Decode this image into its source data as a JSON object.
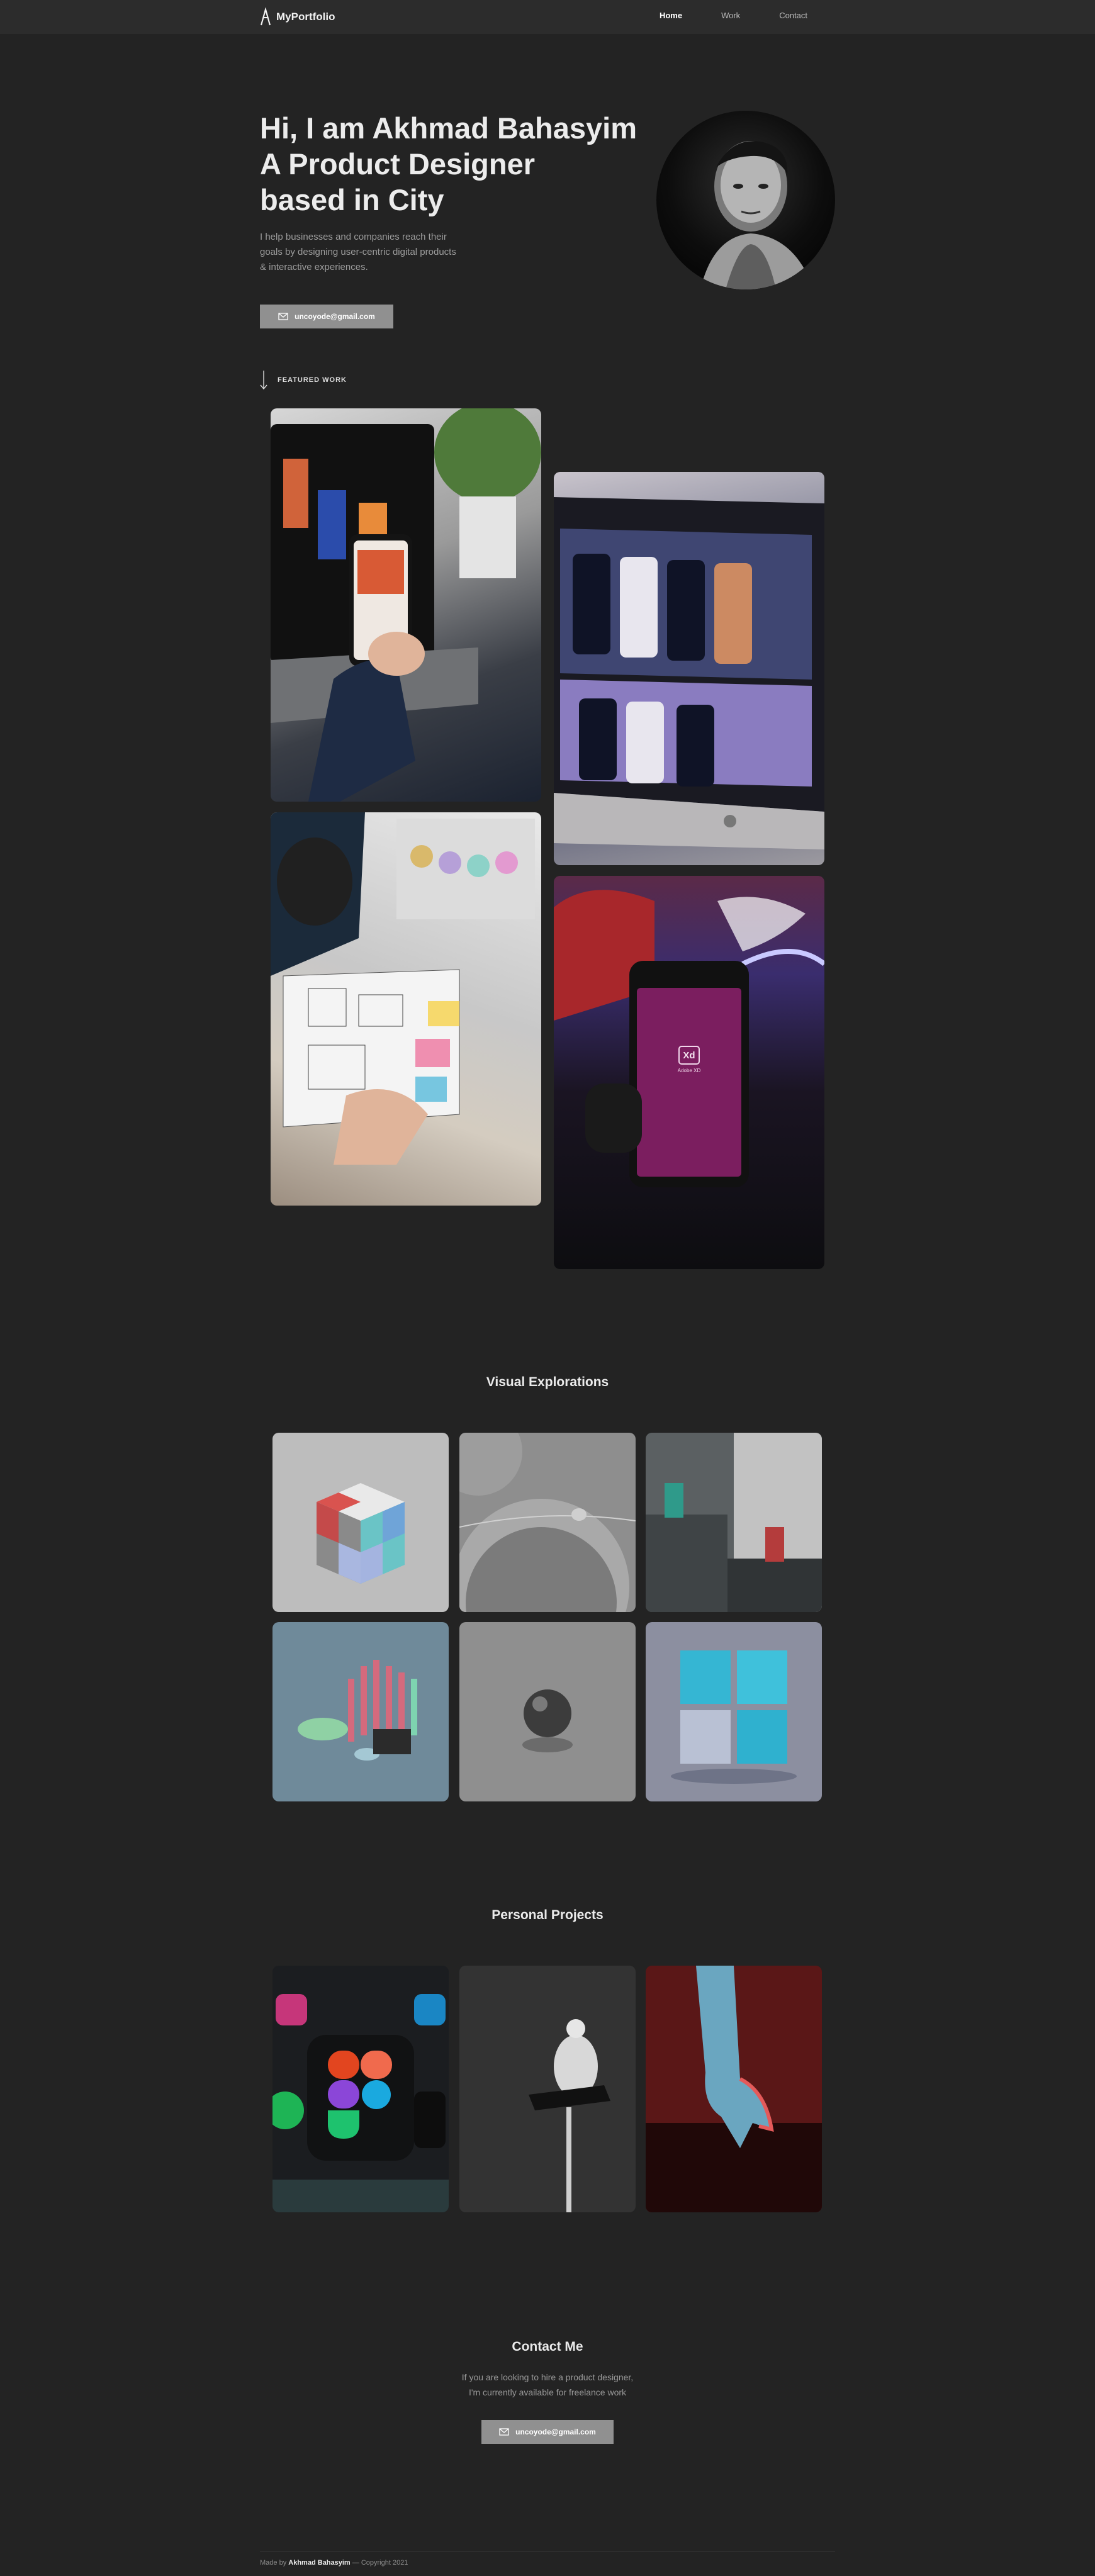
{
  "nav": {
    "brand": "MyPortfolio",
    "links": [
      {
        "label": "Home"
      },
      {
        "label": "Work"
      },
      {
        "label": "Contact"
      }
    ]
  },
  "hero": {
    "title_lines": [
      "Hi, I am Akhmad Bahasyim",
      "A Product Designer",
      "based in City"
    ],
    "subtitle": "I help businesses and companies reach their goals by designing user-centric digital products & interactive experiences.",
    "email_button": "uncoyode@gmail.com"
  },
  "featured": {
    "label": "FEATURED WORK"
  },
  "visual_explorations": {
    "title": "Visual Explorations"
  },
  "personal_projects": {
    "title": "Personal Projects"
  },
  "contact": {
    "title": "Contact Me",
    "line1": "If you are looking to hire a product designer,",
    "line2": "I'm currently available for freelance work",
    "email_button": "uncoyode@gmail.com"
  },
  "footer": {
    "prefix": "Made by",
    "name": "Akhmad Bahasyim",
    "suffix": "— Copyright 2021"
  },
  "colors": {
    "background": "#232323",
    "nav_bg": "#2c2c2c",
    "button_bg": "#909090"
  },
  "work_images": {
    "adobe_xd_badge": "Xd",
    "adobe_xd_label": "Adobe XD"
  }
}
